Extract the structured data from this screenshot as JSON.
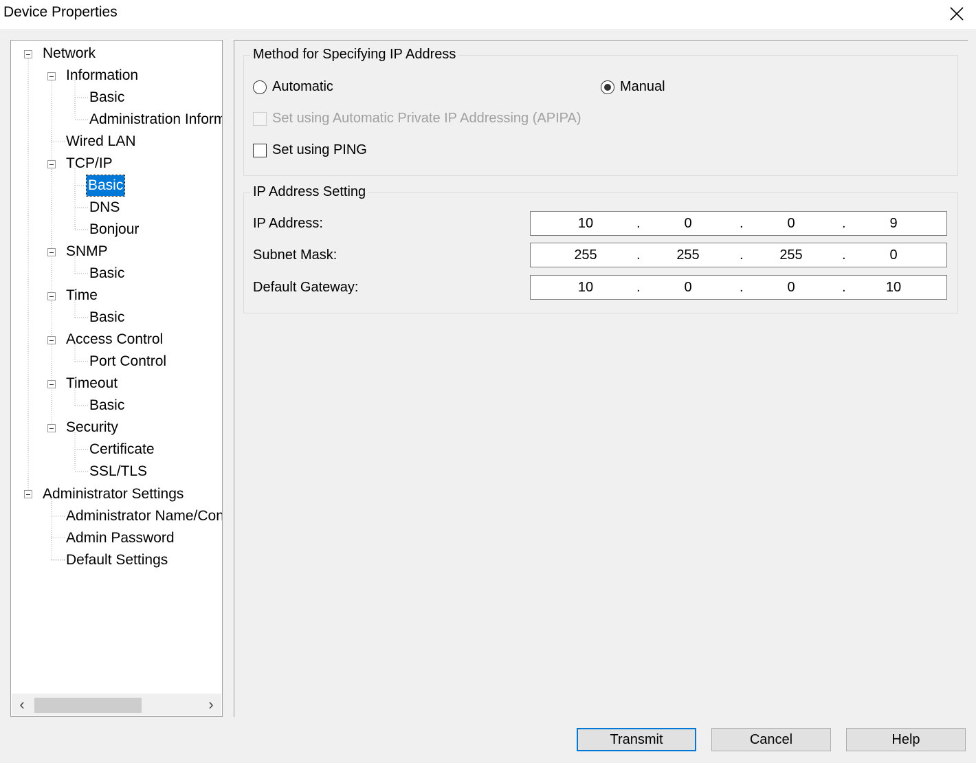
{
  "window": {
    "title": "Device Properties"
  },
  "tree": {
    "items": [
      {
        "label": "Network"
      },
      {
        "label": "Information"
      },
      {
        "label": "Basic"
      },
      {
        "label": "Administration Information"
      },
      {
        "label": "Wired LAN"
      },
      {
        "label": "TCP/IP"
      },
      {
        "label": "Basic"
      },
      {
        "label": "DNS"
      },
      {
        "label": "Bonjour"
      },
      {
        "label": "SNMP"
      },
      {
        "label": "Basic"
      },
      {
        "label": "Time"
      },
      {
        "label": "Basic"
      },
      {
        "label": "Access Control"
      },
      {
        "label": "Port Control"
      },
      {
        "label": "Timeout"
      },
      {
        "label": "Basic"
      },
      {
        "label": "Security"
      },
      {
        "label": "Certificate"
      },
      {
        "label": "SSL/TLS"
      },
      {
        "label": "Administrator Settings"
      },
      {
        "label": "Administrator Name/Contact"
      },
      {
        "label": "Admin Password"
      },
      {
        "label": "Default Settings"
      }
    ],
    "selected_index": 6,
    "scroll_left_icon": "chevron-left-icon",
    "scroll_right_icon": "chevron-right-icon"
  },
  "method_group": {
    "title": "Method for Specifying IP Address",
    "automatic_label": "Automatic",
    "manual_label": "Manual",
    "selected": "Manual",
    "apipa_label": "Set using Automatic Private IP Addressing (APIPA)",
    "apipa_enabled": false,
    "apipa_checked": false,
    "ping_label": "Set using PING",
    "ping_checked": false
  },
  "ip_group": {
    "title": "IP Address Setting",
    "ip_address": {
      "label": "IP Address:",
      "octets": [
        "10",
        "0",
        "0",
        "9"
      ]
    },
    "subnet_mask": {
      "label": "Subnet Mask:",
      "octets": [
        "255",
        "255",
        "255",
        "0"
      ]
    },
    "default_gateway": {
      "label": "Default Gateway:",
      "octets": [
        "10",
        "0",
        "0",
        "10"
      ]
    },
    "separator": "."
  },
  "buttons": {
    "transmit": "Transmit",
    "cancel": "Cancel",
    "help": "Help"
  },
  "colors": {
    "selection": "#0078d7",
    "dialog_bg": "#f0f0f0"
  }
}
